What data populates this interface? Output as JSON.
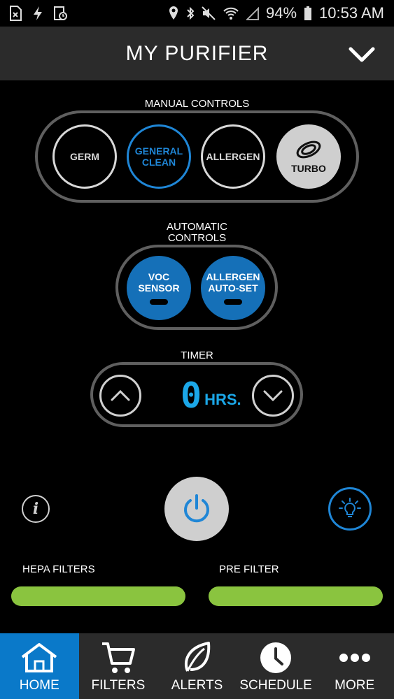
{
  "status_bar": {
    "battery": "94%",
    "time": "10:53 AM"
  },
  "header": {
    "title": "MY PURIFIER"
  },
  "manual_controls": {
    "label": "MANUAL CONTROLS",
    "buttons": [
      {
        "lines": [
          "GERM"
        ],
        "state": "off"
      },
      {
        "lines": [
          "GENERAL",
          "CLEAN"
        ],
        "state": "selected"
      },
      {
        "lines": [
          "ALLERGEN"
        ],
        "state": "off"
      },
      {
        "lines": [
          "TURBO"
        ],
        "state": "filled"
      }
    ]
  },
  "automatic_controls": {
    "label_line1": "AUTOMATIC",
    "label_line2": "CONTROLS",
    "buttons": [
      {
        "line1": "VOC",
        "line2": "SENSOR"
      },
      {
        "line1": "ALLERGEN",
        "line2": "AUTO-SET"
      }
    ]
  },
  "timer": {
    "label": "TIMER",
    "value": "0",
    "unit": "HRS."
  },
  "filters": {
    "hepa_label": "HEPA FILTERS",
    "pre_label": "PRE FILTER",
    "color": "#8ac43f"
  },
  "colors": {
    "accent": "#1f86d6",
    "timer_digits": "#1ba7e8",
    "header_bg": "#2b2b2b",
    "tab_active": "#0a79c9"
  },
  "tabs": [
    {
      "label": "HOME",
      "icon": "home-icon",
      "active": true
    },
    {
      "label": "FILTERS",
      "icon": "cart-icon",
      "active": false
    },
    {
      "label": "ALERTS",
      "icon": "leaf-icon",
      "active": false
    },
    {
      "label": "SCHEDULE",
      "icon": "clock-icon",
      "active": false
    },
    {
      "label": "MORE",
      "icon": "more-dots-icon",
      "active": false
    }
  ]
}
